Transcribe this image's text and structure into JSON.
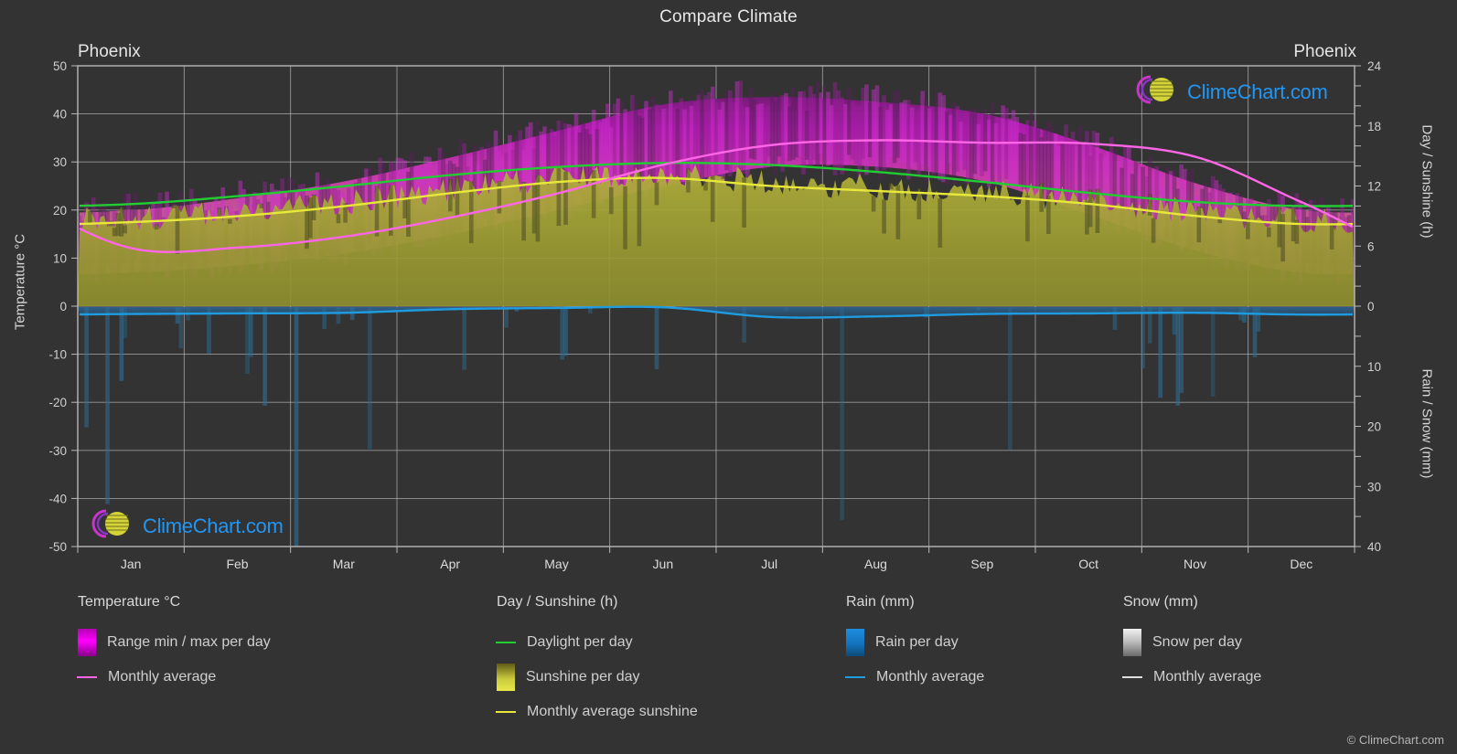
{
  "header": {
    "title": "Compare Climate",
    "city_left": "Phoenix",
    "city_right": "Phoenix"
  },
  "axes": {
    "left_title": "Temperature °C",
    "right_title_top": "Day / Sunshine (h)",
    "right_title_bottom": "Rain / Snow (mm)",
    "temp_ticks": [
      "50",
      "40",
      "30",
      "20",
      "10",
      "0",
      "-10",
      "-20",
      "-30",
      "-40",
      "-50"
    ],
    "sun_ticks": [
      "24",
      "18",
      "12",
      "6",
      "0"
    ],
    "rain_ticks": [
      "0",
      "10",
      "20",
      "30",
      "40"
    ],
    "months": [
      "Jan",
      "Feb",
      "Mar",
      "Apr",
      "May",
      "Jun",
      "Jul",
      "Aug",
      "Sep",
      "Oct",
      "Nov",
      "Dec"
    ]
  },
  "legend": {
    "temperature": {
      "heading": "Temperature °C",
      "items": [
        {
          "label": "Range min / max per day",
          "marker": "gradient-bar",
          "color": "#ff00ff"
        },
        {
          "label": "Monthly average",
          "marker": "line",
          "color": "#ff66e6"
        }
      ]
    },
    "daysunshine": {
      "heading": "Day / Sunshine (h)",
      "items": [
        {
          "label": "Daylight per day",
          "marker": "line",
          "color": "#22cc33"
        },
        {
          "label": "Sunshine per day",
          "marker": "gradient-bar",
          "color": "#e8e84a"
        },
        {
          "label": "Monthly average sunshine",
          "marker": "line",
          "color": "#e8e83a"
        }
      ]
    },
    "rain": {
      "heading": "Rain (mm)",
      "items": [
        {
          "label": "Rain per day",
          "marker": "gradient-bar",
          "color": "#1f8de0"
        },
        {
          "label": "Monthly average",
          "marker": "line",
          "color": "#1f9be0"
        }
      ]
    },
    "snow": {
      "heading": "Snow (mm)",
      "items": [
        {
          "label": "Snow per day",
          "marker": "gradient-bar",
          "color": "#d8d8d8"
        },
        {
          "label": "Monthly average",
          "marker": "line",
          "color": "#e0e0e0"
        }
      ]
    }
  },
  "watermark": {
    "text": "ClimeChart.com",
    "ring_color": "#cc33cc",
    "sphere_color": "#d4d43a",
    "text_color": "#2196f3"
  },
  "footer": {
    "copyright": "© ClimeChart.com"
  },
  "chart_data": {
    "type": "line",
    "title": "Compare Climate",
    "subtitle": "Phoenix",
    "xlabel": "",
    "ylabel": "Temperature °C",
    "ylim": [
      -50,
      50
    ],
    "grid": true,
    "legend_position": "bottom",
    "categories": [
      "Jan",
      "Feb",
      "Mar",
      "Apr",
      "May",
      "Jun",
      "Jul",
      "Aug",
      "Sep",
      "Oct",
      "Nov",
      "Dec"
    ],
    "axis_right_top": {
      "label": "Day / Sunshine (h)",
      "range": [
        0,
        24
      ]
    },
    "axis_right_bottom": {
      "label": "Rain / Snow (mm)",
      "range": [
        0,
        40
      ]
    },
    "series": [
      {
        "name": "Monthly average temperature",
        "unit": "°C",
        "color": "#ff66e6",
        "axis": "left",
        "values": [
          12.0,
          12.2,
          14.5,
          18.5,
          23.5,
          29.5,
          33.5,
          34.5,
          34.0,
          33.8,
          31.0,
          21.5
        ]
      },
      {
        "name": "Daily max temperature (range top)",
        "unit": "°C",
        "color": "#cc00cc",
        "axis": "left",
        "values": [
          20.0,
          22.5,
          26.0,
          31.0,
          36.5,
          42.0,
          43.5,
          42.5,
          40.0,
          33.5,
          25.5,
          20.0
        ]
      },
      {
        "name": "Daily min temperature (range bottom)",
        "unit": "°C",
        "color": "#cc00cc",
        "axis": "left",
        "values": [
          7.0,
          8.5,
          11.0,
          15.0,
          20.0,
          25.0,
          29.0,
          29.0,
          26.0,
          19.0,
          11.5,
          7.0
        ]
      },
      {
        "name": "Daylight per day",
        "unit": "h",
        "color": "#22cc33",
        "axis": "right-top",
        "values": [
          10.2,
          11.0,
          12.0,
          13.1,
          13.9,
          14.3,
          14.1,
          13.4,
          12.4,
          11.3,
          10.4,
          10.0
        ]
      },
      {
        "name": "Monthly average sunshine",
        "unit": "h",
        "color": "#e8e83a",
        "axis": "right-top",
        "values": [
          8.4,
          9.0,
          10.0,
          11.3,
          12.4,
          12.8,
          12.0,
          11.5,
          11.0,
          10.2,
          9.0,
          8.2
        ]
      },
      {
        "name": "Rain monthly average",
        "unit": "mm",
        "color": "#1f9be0",
        "axis": "right-bottom",
        "values": [
          1.3,
          1.2,
          1.1,
          0.5,
          0.3,
          0.2,
          1.8,
          1.7,
          1.3,
          1.2,
          1.1,
          1.4
        ]
      },
      {
        "name": "Snow monthly average",
        "unit": "mm",
        "color": "#e0e0e0",
        "axis": "right-bottom",
        "values": [
          0,
          0,
          0,
          0,
          0,
          0,
          0,
          0,
          0,
          0,
          0,
          0
        ]
      }
    ]
  }
}
